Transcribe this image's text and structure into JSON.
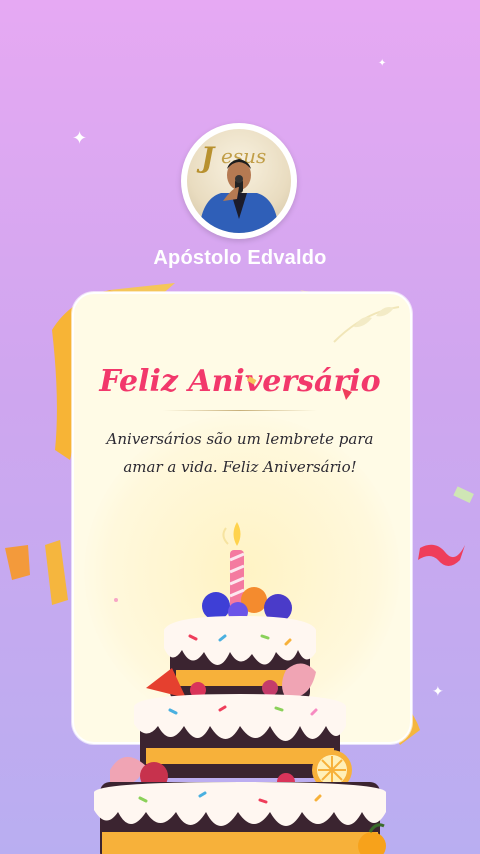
{
  "profile": {
    "name": "Apóstolo Edvaldo",
    "photo_sign_text": "Jesus"
  },
  "card": {
    "title": "Feliz Aniversário",
    "message": "Aniversários são um lembrete para amar a vida. Feliz Aniversário!"
  },
  "colors": {
    "background_top": "#e6a9f3",
    "background_bottom": "#b9aef1",
    "title": "#f2386b",
    "card": "#fffbe6"
  }
}
